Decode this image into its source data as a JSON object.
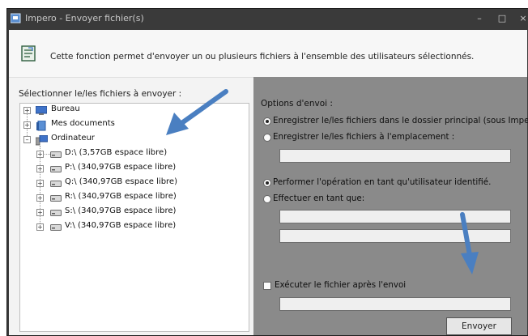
{
  "window": {
    "title": "Impero - Envoyer fichier(s)",
    "minimize_glyph": "–",
    "maximize_glyph": "□",
    "close_glyph": "×"
  },
  "header": {
    "description": "Cette fonction permet d'envoyer un ou plusieurs fichiers à l'ensemble des utilisateurs sélectionnés."
  },
  "file_selection": {
    "label": "Sélectionner le/les fichiers à envoyer :",
    "tree": [
      {
        "label": "Bureau",
        "icon": "desktop-icon",
        "expander": "+"
      },
      {
        "label": "Mes documents",
        "icon": "documents-icon",
        "expander": "+"
      },
      {
        "label": "Ordinateur",
        "icon": "computer-icon",
        "expander": "–"
      },
      {
        "label": "D:\\  (3,57GB espace libre)",
        "icon": "drive-icon",
        "expander": "+"
      },
      {
        "label": "P:\\  (340,97GB espace libre)",
        "icon": "drive-icon",
        "expander": "+"
      },
      {
        "label": "Q:\\  (340,97GB espace libre)",
        "icon": "drive-icon",
        "expander": "+"
      },
      {
        "label": "R:\\  (340,97GB espace libre)",
        "icon": "drive-icon",
        "expander": "+"
      },
      {
        "label": "S:\\  (340,97GB espace libre)",
        "icon": "drive-icon",
        "expander": "+"
      },
      {
        "label": "V:\\  (340,97GB espace libre)",
        "icon": "drive-icon",
        "expander": "+"
      }
    ]
  },
  "options": {
    "title": "Options d'envoi :",
    "save_main": "Enregistrer le/les fichiers dans le dossier principal (sous ImperoDownl",
    "save_location": "Enregistrer le/les fichiers à l'emplacement :",
    "location_value": "",
    "as_identified_user": "Performer l'opération en tant qu'utilisateur identifié.",
    "run_as": "Effectuer en tant que:",
    "run_as_user_value": "",
    "run_as_password_value": "",
    "execute_after": "Exécuter le fichier après l'envoi",
    "execute_args_value": "",
    "send_button": "Envoyer"
  },
  "colors": {
    "accent_arrow": "#4a7fc1",
    "panel": "#8a8a8a",
    "titlebar": "#3a3a3a"
  }
}
